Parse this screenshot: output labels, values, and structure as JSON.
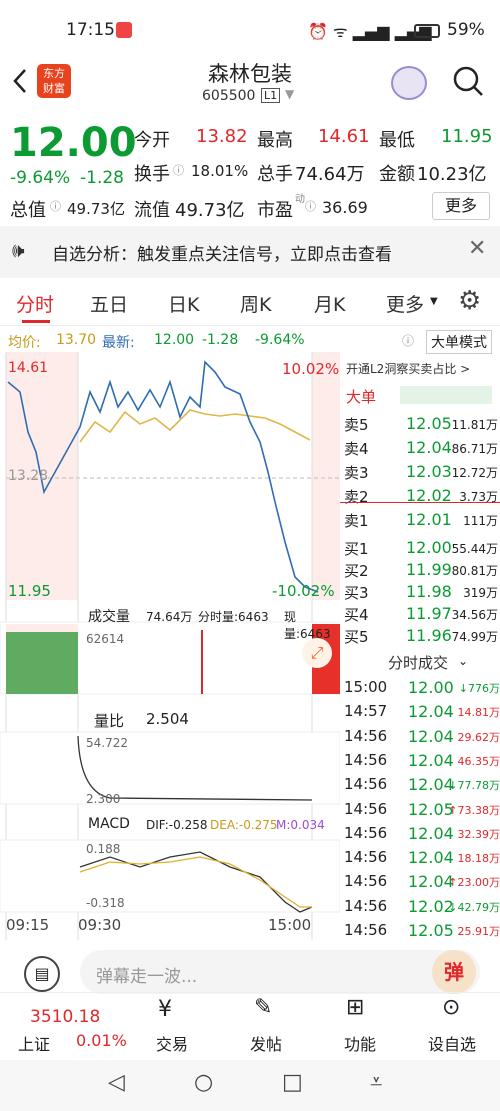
{
  "status": {
    "time": "17:15",
    "battery": "59%"
  },
  "header": {
    "logo_line1": "东方",
    "logo_line2": "财富",
    "name": "森林包装",
    "code": "605500",
    "level": "L1"
  },
  "quote": {
    "price": "12.00",
    "change_pct": "-9.64%",
    "change": "-1.28",
    "open_label": "今开",
    "open": "13.82",
    "high_label": "最高",
    "high": "14.61",
    "low_label": "最低",
    "low": "11.95",
    "turnover_label": "换手",
    "turnover": "18.01%",
    "volume_label": "总手",
    "volume": "74.64万",
    "amount_label": "金额",
    "amount": "10.23亿",
    "mcap_label": "总值",
    "mcap": "49.73亿",
    "float_label": "流值",
    "float": "49.73亿",
    "pe_label": "市盈",
    "pe_sup": "动",
    "pe": "36.69",
    "more": "更多"
  },
  "alert": {
    "text": "自选分析：触发重点关注信号，立即点击查看"
  },
  "tabs": [
    "分时",
    "五日",
    "日K",
    "周K",
    "月K",
    "更多"
  ],
  "chart": {
    "avg_label": "均价:",
    "avg": "13.70",
    "last_label": "最新:",
    "last": "12.00",
    "chg": "-1.28",
    "pct": "-9.64%",
    "big_order": "大单模式",
    "y_top_left": "14.61",
    "y_top_right": "10.02%",
    "y_mid": "13.28",
    "y_bot_left": "11.95",
    "y_bot_right": "-10.02%",
    "vol_label": "成交量",
    "vol_total": "74.64万",
    "vol_tick_label": "分时量:6463",
    "vol_now_label": "现量:6463",
    "vol_max": "62614",
    "ratio_label": "量比",
    "ratio": "2.504",
    "ratio_top": "54.722",
    "ratio_bot": "2.300",
    "macd_label": "MACD",
    "dif": "DIF:-0.258",
    "dea": "DEA:-0.275",
    "m": "M:0.034",
    "macd_top": "0.188",
    "macd_bot": "-0.318",
    "x_labels": [
      "09:15",
      "09:30",
      "15:00"
    ]
  },
  "book": {
    "banner": "开通L2洞察买卖占比 >",
    "big": "大单",
    "asks": [
      {
        "l": "卖5",
        "p": "12.05",
        "v": "11.81万"
      },
      {
        "l": "卖4",
        "p": "12.04",
        "v": "86.71万"
      },
      {
        "l": "卖3",
        "p": "12.03",
        "v": "12.72万"
      },
      {
        "l": "卖2",
        "p": "12.02",
        "v": "3.73万"
      },
      {
        "l": "卖1",
        "p": "12.01",
        "v": "111万"
      }
    ],
    "bids": [
      {
        "l": "买1",
        "p": "12.00",
        "v": "55.44万"
      },
      {
        "l": "买2",
        "p": "11.99",
        "v": "80.81万"
      },
      {
        "l": "买3",
        "p": "11.98",
        "v": "319万"
      },
      {
        "l": "买4",
        "p": "11.97",
        "v": "34.56万"
      },
      {
        "l": "买5",
        "p": "11.96",
        "v": "74.99万"
      }
    ],
    "trades_title": "分时成交",
    "trades": [
      {
        "t": "15:00",
        "p": "12.00",
        "v": "776万",
        "d": "down"
      },
      {
        "t": "14:57",
        "p": "12.04",
        "v": "14.81万",
        "d": ""
      },
      {
        "t": "14:56",
        "p": "12.04",
        "v": "29.62万",
        "d": ""
      },
      {
        "t": "14:56",
        "p": "12.04",
        "v": "46.35万",
        "d": ""
      },
      {
        "t": "14:56",
        "p": "12.04",
        "v": "77.78万",
        "d": "down"
      },
      {
        "t": "14:56",
        "p": "12.05",
        "v": "73.38万",
        "d": "up"
      },
      {
        "t": "14:56",
        "p": "12.04",
        "v": "32.39万",
        "d": ""
      },
      {
        "t": "14:56",
        "p": "12.04",
        "v": "18.18万",
        "d": ""
      },
      {
        "t": "14:56",
        "p": "12.04",
        "v": "23.00万",
        "d": "up"
      },
      {
        "t": "14:56",
        "p": "12.02",
        "v": "42.79万",
        "d": "down"
      },
      {
        "t": "14:56",
        "p": "12.05",
        "v": "25.91万",
        "d": ""
      }
    ]
  },
  "danmu": {
    "placeholder": "弹幕走一波...",
    "btn": "弹"
  },
  "bottom": {
    "index_value": "3510.18",
    "index_name": "上证",
    "index_pct": "0.01%",
    "trade": "交易",
    "post": "发帖",
    "func": "功能",
    "watch": "设自选"
  }
}
